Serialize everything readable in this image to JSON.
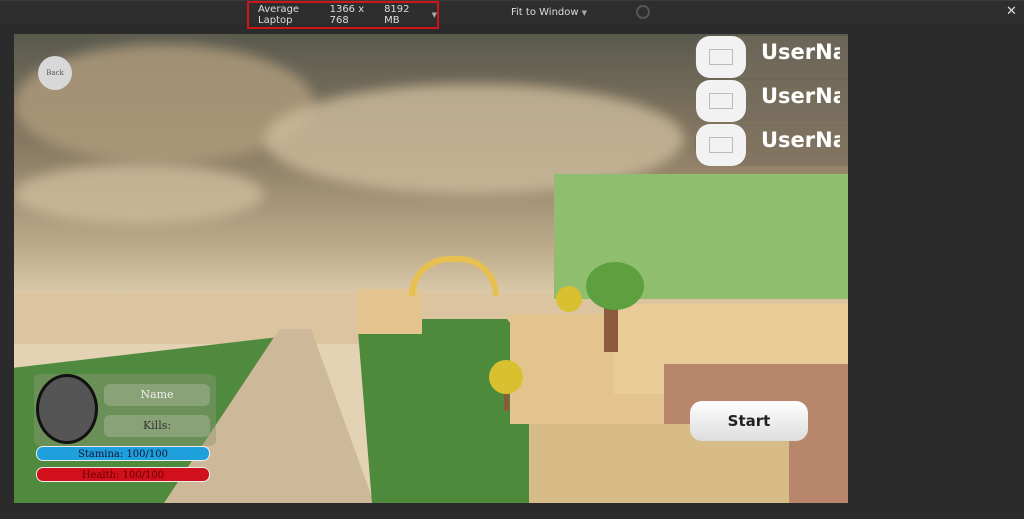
{
  "toolbar": {
    "device": "Average Laptop",
    "resolution": "1366 x 768",
    "memory": "8192 MB",
    "fit": "Fit to Window"
  },
  "game": {
    "back_label": "Back",
    "leaderboard": [
      {
        "name": "UserName"
      },
      {
        "name": "UserName"
      },
      {
        "name": "UserName"
      }
    ],
    "player": {
      "name_label": "Name",
      "kills_label": "Kills:",
      "stamina": "Stamina: 100/100",
      "health": "Health: 100/100",
      "stamina_value": 100,
      "health_value": 100
    },
    "start_label": "Start"
  },
  "colors": {
    "highlight": "#d0151a",
    "stamina": "#1ea0dc",
    "health": "#d0101a"
  }
}
